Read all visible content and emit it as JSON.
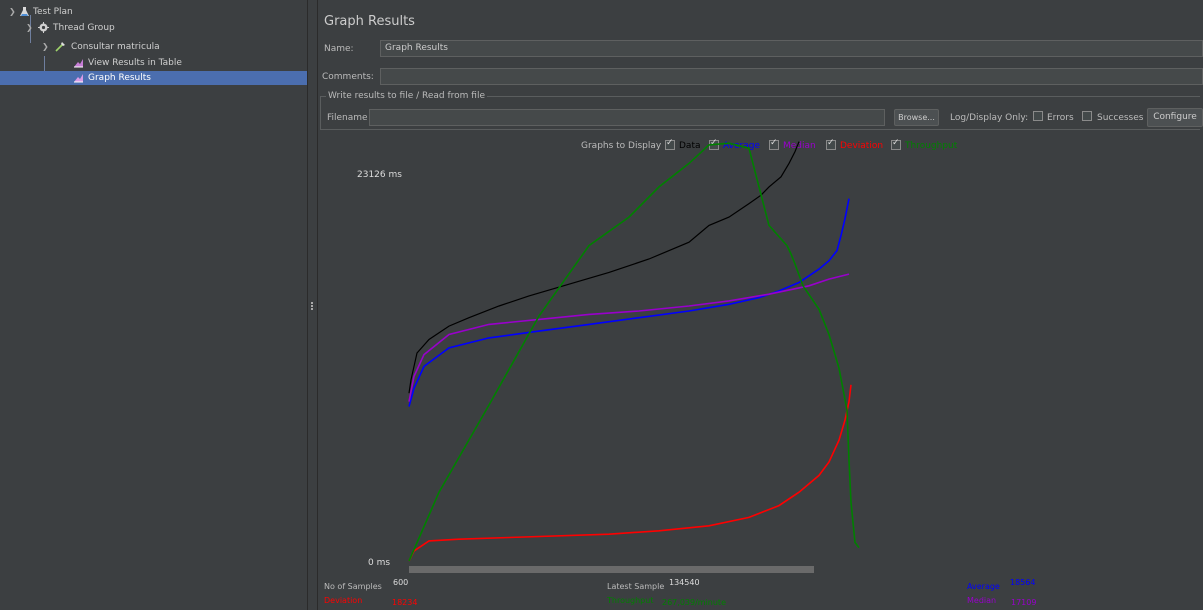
{
  "tree": {
    "items": [
      {
        "label": "Test Plan",
        "icon": "flask-icon"
      },
      {
        "label": "Thread Group",
        "icon": "gear-icon"
      },
      {
        "label": "Consultar matricula",
        "icon": "pipette-icon"
      },
      {
        "label": "View Results in Table",
        "icon": "chart-icon"
      },
      {
        "label": "Graph Results",
        "icon": "chart-icon"
      }
    ]
  },
  "panel": {
    "title": "Graph Results",
    "name_label": "Name:",
    "name_value": "Graph Results",
    "comments_label": "Comments:",
    "comments_value": "",
    "file_group_label": "Write results to file / Read from file",
    "filename_label": "Filename",
    "filename_value": "",
    "browse_label": "Browse...",
    "log_display_label": "Log/Display Only:",
    "errors_label": "Errors",
    "successes_label": "Successes",
    "configure_label": "Configure"
  },
  "graphs_to_display": {
    "label": "Graphs to Display",
    "options": [
      {
        "label": "Data",
        "checked": true,
        "color": "#000000"
      },
      {
        "label": "Average",
        "checked": true,
        "color": "#0000ff"
      },
      {
        "label": "Median",
        "checked": true,
        "color": "#9900cc"
      },
      {
        "label": "Deviation",
        "checked": true,
        "color": "#ff0000"
      },
      {
        "label": "Throughput",
        "checked": true,
        "color": "#008000"
      }
    ]
  },
  "chart_data": {
    "type": "line",
    "ymax_label": "23126",
    "ymin_label": "0",
    "y_unit": "ms",
    "ylim": [
      0,
      23126
    ],
    "x_samples": [
      0,
      600
    ],
    "series": [
      {
        "name": "Data",
        "color": "#000000",
        "x": [
          0,
          2,
          8,
          20,
          40,
          60,
          90,
          120,
          160,
          200,
          240,
          280,
          300,
          320,
          340,
          352,
          360,
          372,
          380,
          386,
          390
        ],
        "y": [
          10000,
          10800,
          12400,
          13200,
          14000,
          14500,
          15200,
          15800,
          16500,
          17200,
          18000,
          19000,
          20000,
          20500,
          21300,
          21800,
          22300,
          22900,
          23700,
          24400,
          25000
        ]
      },
      {
        "name": "Average",
        "color": "#0000ff",
        "x": [
          0,
          5,
          15,
          40,
          80,
          130,
          180,
          230,
          280,
          320,
          350,
          370,
          390,
          400,
          410,
          420,
          428,
          432,
          436,
          440
        ],
        "y": [
          9200,
          10300,
          11600,
          12700,
          13300,
          13700,
          14100,
          14500,
          14900,
          15300,
          15700,
          16100,
          16600,
          17000,
          17400,
          17900,
          18500,
          19400,
          20400,
          21600
        ]
      },
      {
        "name": "Median",
        "color": "#9900cc",
        "x": [
          0,
          5,
          15,
          40,
          80,
          130,
          180,
          230,
          280,
          320,
          360,
          400,
          420,
          440
        ],
        "y": [
          9500,
          11000,
          12300,
          13500,
          14100,
          14400,
          14700,
          14900,
          15200,
          15500,
          15900,
          16400,
          16800,
          17100
        ]
      },
      {
        "name": "Deviation",
        "color": "#ff0000",
        "x": [
          0,
          5,
          20,
          50,
          100,
          200,
          250,
          300,
          340,
          370,
          390,
          410,
          420,
          430,
          436,
          440,
          442
        ],
        "y": [
          0,
          600,
          1200,
          1300,
          1400,
          1600,
          1800,
          2100,
          2600,
          3300,
          4100,
          5100,
          5900,
          7200,
          8400,
          9500,
          10500
        ]
      },
      {
        "name": "Throughput",
        "color": "#008000",
        "x": [
          0,
          30,
          80,
          130,
          180,
          220,
          250,
          280,
          300,
          320,
          340,
          360,
          378,
          382,
          386,
          394,
          410,
          420,
          430,
          438,
          440,
          442,
          446,
          450
        ],
        "y": [
          0,
          4100,
          9300,
          14600,
          18800,
          20500,
          22300,
          23700,
          24800,
          24900,
          24600,
          20000,
          18800,
          18300,
          17700,
          16400,
          15000,
          13500,
          11500,
          9000,
          6000,
          3500,
          1100,
          800
        ]
      }
    ]
  },
  "stats": {
    "samples_label": "No of Samples",
    "samples_value": "600",
    "latest_label": "Latest Sample",
    "latest_value": "134540",
    "average_label": "Average",
    "average_value": "18564",
    "deviation_label": "Deviation",
    "deviation_value": "18234",
    "throughput_label": "Throughput",
    "throughput_value": "267,039/minute",
    "median_label": "Median",
    "median_value": "17109"
  },
  "colors": {
    "black": "#000000",
    "average": "#0000ff",
    "median": "#9900cc",
    "deviation": "#ff0000",
    "throughput": "#008000",
    "selection": "#4b6eaf"
  }
}
